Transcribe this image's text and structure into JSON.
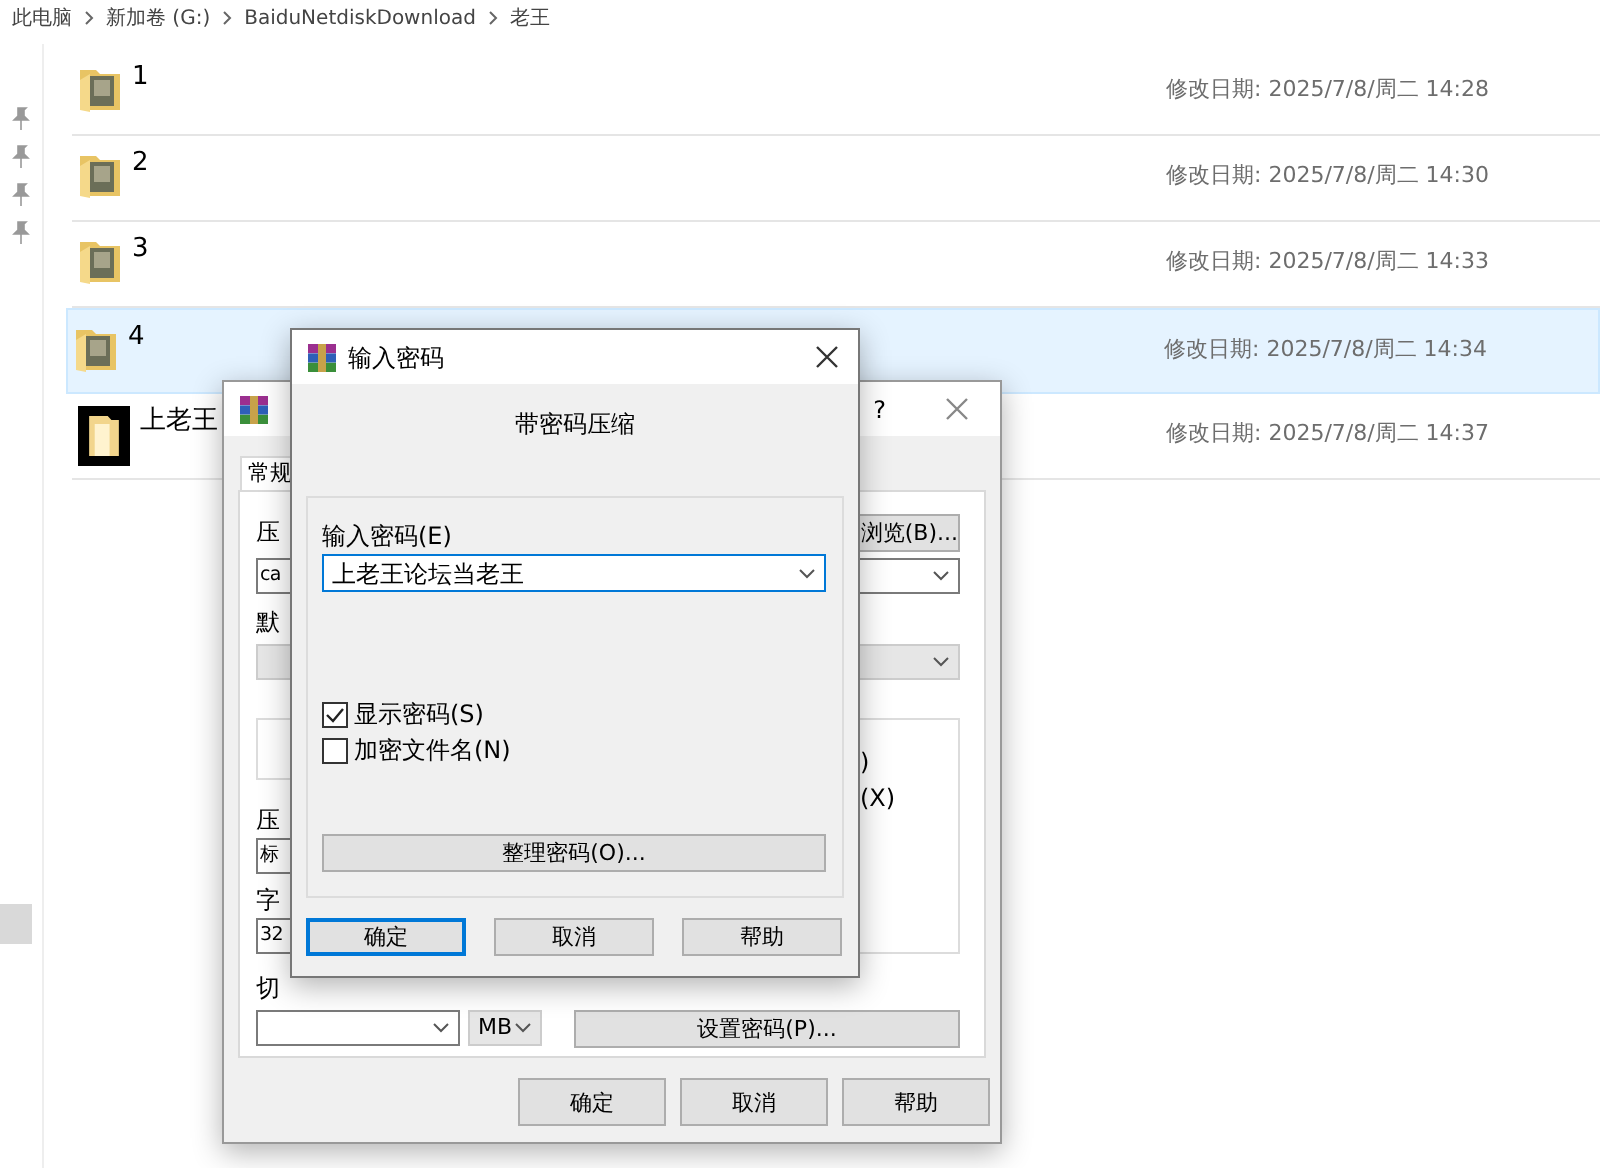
{
  "breadcrumb": [
    "此电脑",
    "新加卷 (G:)",
    "BaiduNetdiskDownload",
    "老王"
  ],
  "files": [
    {
      "name": "1",
      "modified": "修改日期: 2025/7/8/周二 14:28",
      "kind": "folder",
      "selected": false
    },
    {
      "name": "2",
      "modified": "修改日期: 2025/7/8/周二 14:30",
      "kind": "folder",
      "selected": false
    },
    {
      "name": "3",
      "modified": "修改日期: 2025/7/8/周二 14:33",
      "kind": "folder",
      "selected": false
    },
    {
      "name": "4",
      "modified": "修改日期: 2025/7/8/周二 14:34",
      "kind": "folder",
      "selected": true
    },
    {
      "name": "上老王",
      "modified": "修改日期: 2025/7/8/周二 14:37",
      "kind": "thumbnail",
      "selected": false
    }
  ],
  "archive_dialog": {
    "help": "?",
    "tab": "常规",
    "name_label": "压",
    "browse_button": "浏览(B)...",
    "name_value": "ca",
    "profile_label": "默",
    "options_fragments": [
      ")",
      "(X)"
    ],
    "method_label": "压",
    "method_value": "标",
    "dict_label": "字",
    "dict_value": "32",
    "split_label": "切",
    "split_unit": "MB",
    "set_password_button": "设置密码(P)...",
    "buttons": [
      "确定",
      "取消",
      "帮助"
    ]
  },
  "password_dialog": {
    "title": "输入密码",
    "heading": "带密码压缩",
    "password_label": "输入密码(E)",
    "password_value": "上老王论坛当老王",
    "options": [
      {
        "label": "显示密码(S)",
        "checked": true
      },
      {
        "label": "加密文件名(N)",
        "checked": false
      }
    ],
    "organize_button": "整理密码(O)...",
    "buttons": [
      {
        "label": "确定",
        "default": true
      },
      {
        "label": "取消",
        "default": false
      },
      {
        "label": "帮助",
        "default": false
      }
    ]
  }
}
